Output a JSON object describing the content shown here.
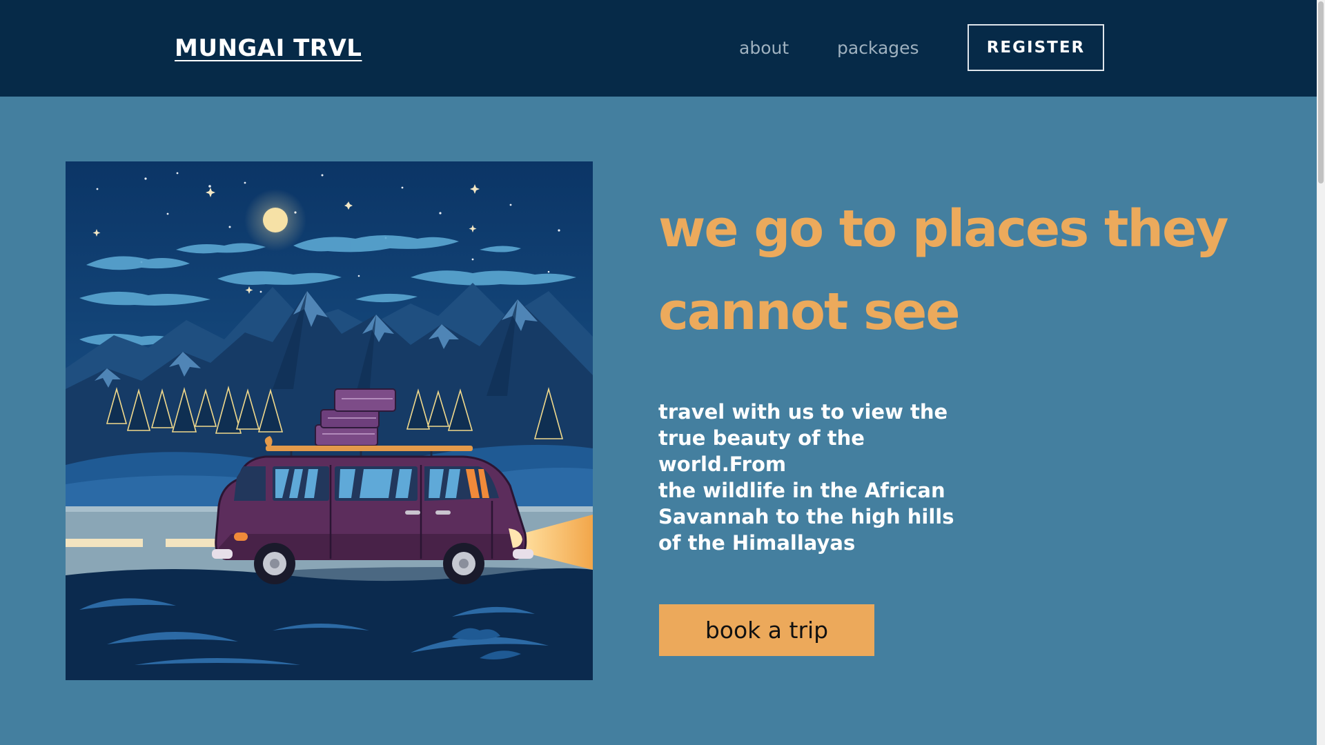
{
  "header": {
    "logo": "MUNGAI TRVL",
    "nav": [
      {
        "label": "about"
      },
      {
        "label": "packages"
      }
    ],
    "register_label": "REGISTER"
  },
  "hero": {
    "headline": "we go to places they cannot see",
    "description": "travel with us to view the\ntrue beauty of the\nworld.From\nthe wildlife in the African\nSavannah to the high hills\nof the Himallayas",
    "cta_label": "book a trip",
    "illustration": "night-mountain-road-van-illustration"
  },
  "colors": {
    "header_bg": "#062a48",
    "page_bg": "#447f9f",
    "accent": "#eca95b",
    "van": "#5c2d5c"
  }
}
